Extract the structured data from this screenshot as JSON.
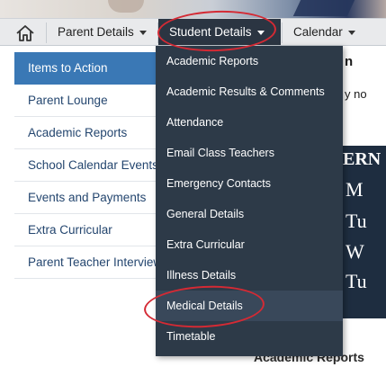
{
  "navbar": {
    "home_icon": "home-icon",
    "items": [
      {
        "label": "Parent Details"
      },
      {
        "label": "Student Details"
      },
      {
        "label": "Calendar"
      }
    ]
  },
  "sidebar": {
    "items": [
      {
        "label": "Items to Action"
      },
      {
        "label": "Parent Lounge"
      },
      {
        "label": "Academic Reports"
      },
      {
        "label": "School Calendar Events"
      },
      {
        "label": "Events and Payments"
      },
      {
        "label": "Extra Curricular"
      },
      {
        "label": "Parent Teacher Interviews"
      }
    ]
  },
  "dropdown": {
    "items": [
      {
        "label": "Academic Reports"
      },
      {
        "label": "Academic Results & Comments"
      },
      {
        "label": "Attendance"
      },
      {
        "label": "Email Class Teachers"
      },
      {
        "label": "Emergency Contacts"
      },
      {
        "label": "General Details"
      },
      {
        "label": "Extra Curricular"
      },
      {
        "label": "Illness Details"
      },
      {
        "label": "Medical Details"
      },
      {
        "label": "Timetable"
      }
    ]
  },
  "background": {
    "fragment_n": "n",
    "fragment_y_no": "y no",
    "serif_lines": [
      "ERN",
      "M",
      "Tu",
      "W",
      "Tu"
    ],
    "bottom_heading": "Academic Reports"
  },
  "colors": {
    "navbar_active": "#2b3542",
    "dropdown_bg": "#2d3a48",
    "sidebar_active": "#3a78b5",
    "link": "#24466f",
    "annotation": "#d42a34"
  }
}
